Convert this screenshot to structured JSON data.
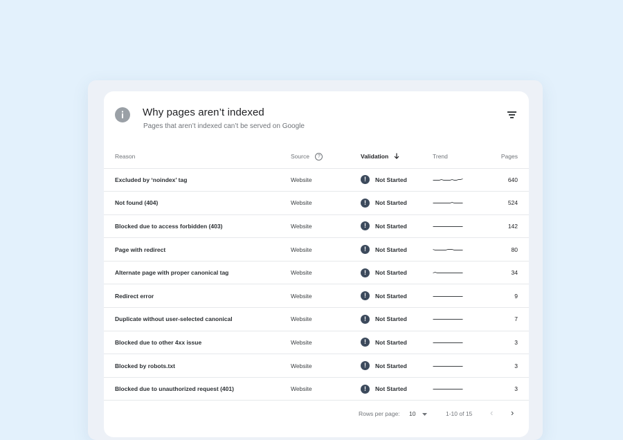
{
  "panel": {
    "title": "Why pages aren’t indexed",
    "subtitle": "Pages that aren’t indexed can’t be served on Google",
    "info_icon": "info-icon",
    "filter_icon": "filter-icon"
  },
  "table": {
    "headers": {
      "reason": "Reason",
      "source": "Source",
      "source_help_icon": "?",
      "validation": "Validation",
      "trend": "Trend",
      "pages": "Pages"
    },
    "status_icon_glyph": "!",
    "rows": [
      {
        "reason": "Excluded by ‘noindex’ tag",
        "source": "Website",
        "validation": "Not Started",
        "pages": "640",
        "trend": [
          3,
          3,
          3,
          3,
          2,
          3,
          3,
          3,
          3,
          2,
          3,
          3,
          2,
          2,
          1
        ]
      },
      {
        "reason": "Not found (404)",
        "source": "Website",
        "validation": "Not Started",
        "pages": "524",
        "trend": [
          3,
          3,
          3,
          3,
          3,
          3,
          3,
          3,
          3,
          2,
          3,
          3,
          3,
          3,
          3
        ]
      },
      {
        "reason": "Blocked due to access forbidden (403)",
        "source": "Website",
        "validation": "Not Started",
        "pages": "142",
        "trend": [
          3,
          3,
          3,
          3,
          3,
          3,
          3,
          3,
          3,
          3,
          3,
          3,
          3,
          3,
          3
        ]
      },
      {
        "reason": "Page with redirect",
        "source": "Website",
        "validation": "Not Started",
        "pages": "80",
        "trend": [
          2,
          3,
          3,
          3,
          3,
          3,
          3,
          2,
          2,
          2,
          3,
          3,
          3,
          3,
          3
        ]
      },
      {
        "reason": "Alternate page with proper canonical tag",
        "source": "Website",
        "validation": "Not Started",
        "pages": "34",
        "trend": [
          3,
          2,
          3,
          3,
          3,
          3,
          3,
          3,
          3,
          3,
          3,
          3,
          3,
          3,
          3
        ]
      },
      {
        "reason": "Redirect error",
        "source": "Website",
        "validation": "Not Started",
        "pages": "9",
        "trend": [
          3,
          3,
          3,
          3,
          3,
          3,
          3,
          3,
          3,
          3,
          3,
          3,
          3,
          3,
          3
        ]
      },
      {
        "reason": "Duplicate without user-selected canonical",
        "source": "Website",
        "validation": "Not Started",
        "pages": "7",
        "trend": [
          3,
          3,
          3,
          3,
          3,
          3,
          3,
          3,
          3,
          3,
          3,
          3,
          3,
          3,
          3
        ]
      },
      {
        "reason": "Blocked due to other 4xx issue",
        "source": "Website",
        "validation": "Not Started",
        "pages": "3",
        "trend": [
          3,
          3,
          3,
          3,
          3,
          3,
          3,
          3,
          3,
          3,
          3,
          3,
          3,
          3,
          3
        ]
      },
      {
        "reason": "Blocked by robots.txt",
        "source": "Website",
        "validation": "Not Started",
        "pages": "3",
        "trend": [
          3,
          3,
          3,
          3,
          3,
          3,
          3,
          3,
          3,
          3,
          3,
          3,
          3,
          3,
          3
        ]
      },
      {
        "reason": "Blocked due to unauthorized request (401)",
        "source": "Website",
        "validation": "Not Started",
        "pages": "3",
        "trend": [
          3,
          3,
          3,
          3,
          3,
          3,
          3,
          3,
          3,
          3,
          3,
          3,
          3,
          3,
          3
        ]
      }
    ]
  },
  "footer": {
    "rows_per_page_label": "Rows per page:",
    "rows_per_page_value": "10",
    "range_label": "1-10 of 15",
    "prev_icon": "‹",
    "next_icon": "›"
  },
  "colors": {
    "background": "#e3f1fc",
    "status_icon": "#3c4a5c",
    "trend_line": "#3c4043"
  }
}
